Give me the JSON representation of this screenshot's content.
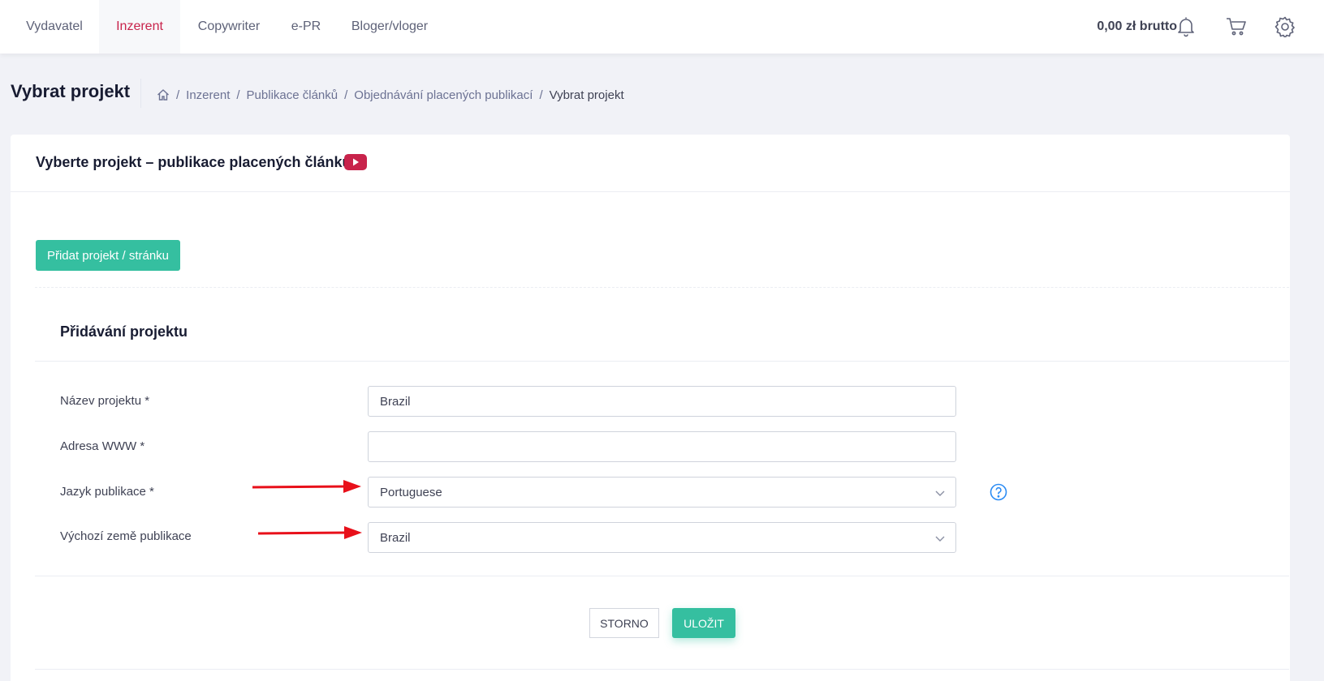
{
  "nav": {
    "tabs": [
      {
        "label": "Vydavatel"
      },
      {
        "label": "Inzerent"
      },
      {
        "label": "Copywriter"
      },
      {
        "label": "e-PR"
      },
      {
        "label": "Bloger/vloger"
      }
    ],
    "active_tab": "Inzerent",
    "balance": "0,00 zł brutto",
    "icons": [
      "bell-icon",
      "cart-icon",
      "gear-icon"
    ]
  },
  "subheader": {
    "title": "Vybrat projekt",
    "breadcrumb": {
      "home_icon": "home-icon",
      "items": [
        "Inzerent",
        "Publikace článků",
        "Objednávání placených publikací",
        "Vybrat projekt"
      ]
    }
  },
  "card": {
    "title": "Vyberte projekt – publikace placených článků",
    "video_icon": "youtube-icon",
    "add_button": "Přidat projekt / stránku",
    "section_title": "Přidávání projektu",
    "fields": [
      {
        "label": "Název projektu *",
        "value": "Brazil",
        "type": "text"
      },
      {
        "label": "Adresa WWW *",
        "value": "",
        "type": "text"
      },
      {
        "label": "Jazyk publikace *",
        "value": "Portuguese",
        "type": "select"
      },
      {
        "label": "Výchozí země publikace",
        "value": "Brazil",
        "type": "select"
      }
    ],
    "cancel_button": "STORNO",
    "save_button": "ULOŽIT"
  },
  "colors": {
    "accent": "#35bfa0",
    "active_tab": "#c8234b",
    "annotation_arrow": "#e8101a",
    "youtube": "#c8234b",
    "help": "#2c8cf4"
  }
}
